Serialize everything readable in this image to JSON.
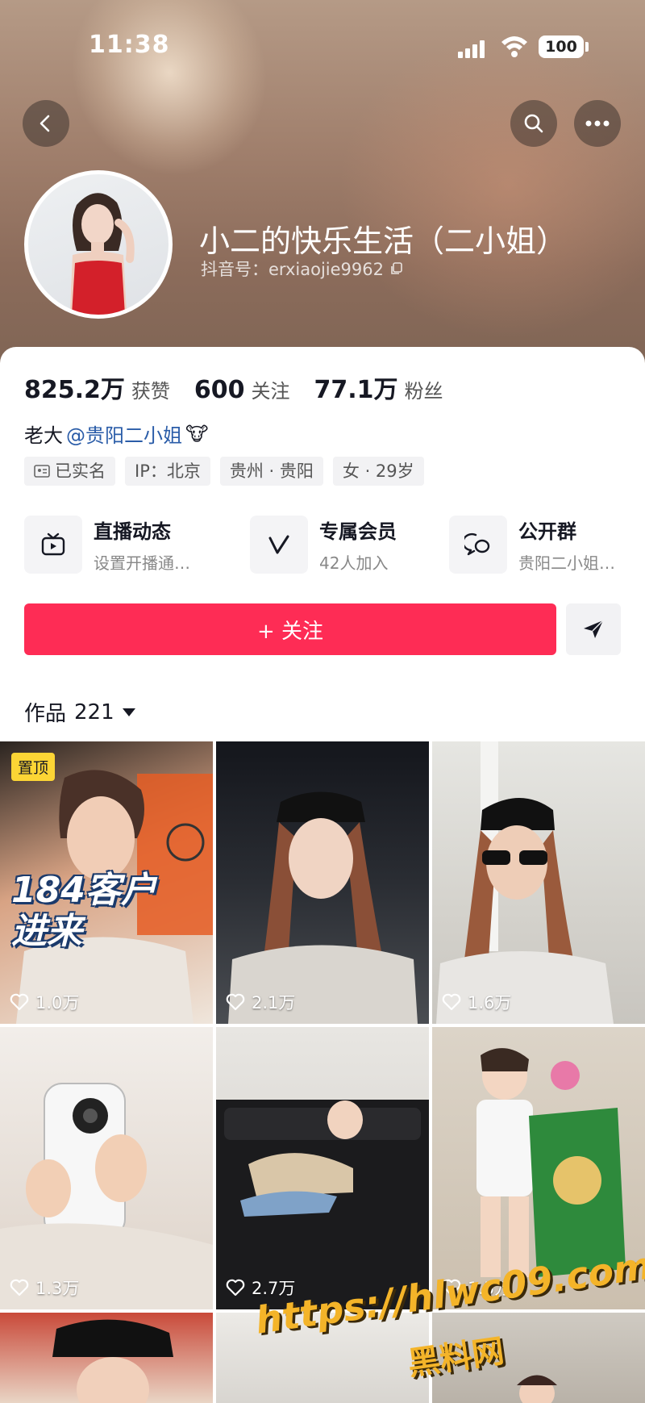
{
  "status_bar": {
    "time": "11:38",
    "battery": "100"
  },
  "profile": {
    "nickname": "小二的快乐生活（二小姐）",
    "douyin_id": "抖音号：erxiaojie9962",
    "stats": [
      {
        "value": "825.2万",
        "label": "获赞"
      },
      {
        "value": "600",
        "label": "关注"
      },
      {
        "value": "77.1万",
        "label": "粉丝"
      }
    ],
    "bio": {
      "prefix": "老大",
      "mention": "@贵阳二小姐",
      "emoji": "🐮"
    },
    "tags": [
      "已实名",
      "IP：北京",
      "贵州 · 贵阳",
      "女 · 29岁"
    ]
  },
  "features": [
    {
      "title": "直播动态",
      "subtitle": "设置开播通…",
      "icon": "live-tv-icon"
    },
    {
      "title": "专属会员",
      "subtitle": "42人加入",
      "icon": "v-member-icon"
    },
    {
      "title": "公开群",
      "subtitle": "贵阳二小姐…",
      "icon": "chat-group-icon"
    }
  ],
  "actions": {
    "follow_label": "+ 关注",
    "share_icon": "send-icon"
  },
  "works": {
    "label": "作品",
    "count": "221",
    "pinned_label": "置顶",
    "videos": [
      {
        "likes": "1.0万",
        "overlay": "184客户\n进来"
      },
      {
        "likes": "2.1万"
      },
      {
        "likes": "1.6万"
      },
      {
        "likes": "1.3万"
      },
      {
        "likes": "2.7万"
      },
      {
        "likes": "1.5万"
      }
    ]
  },
  "watermark": {
    "url": "https://hlwc09.com",
    "name": "黑料网"
  },
  "colors": {
    "follow": "#fe2c55",
    "mention": "#2a5ca8",
    "pinned": "#fcd535",
    "watermark": "#f4b429"
  }
}
